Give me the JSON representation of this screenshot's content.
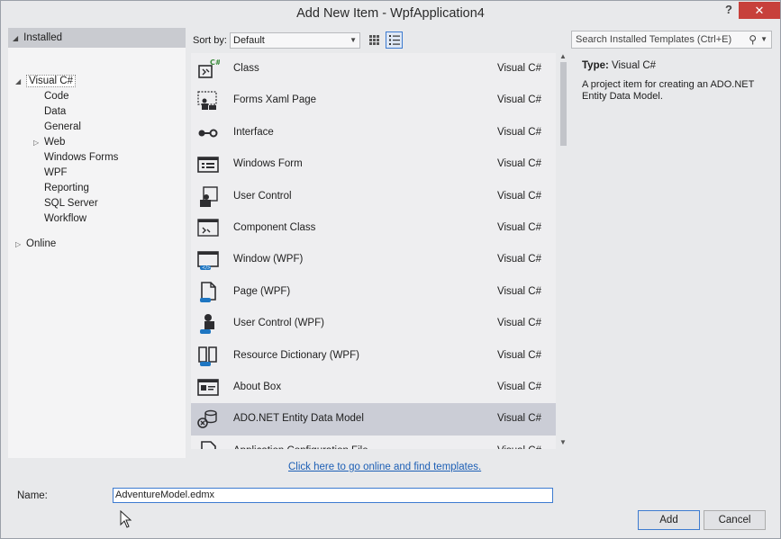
{
  "window": {
    "title": "Add New Item - WpfApplication4",
    "help_label": "?",
    "close_label": "✕"
  },
  "left_pane": {
    "installed_label": "Installed",
    "tree": [
      {
        "label": "Visual C#",
        "level": 0,
        "expanded": true,
        "selected": true
      },
      {
        "label": "Code",
        "level": 1
      },
      {
        "label": "Data",
        "level": 1
      },
      {
        "label": "General",
        "level": 1
      },
      {
        "label": "Web",
        "level": 1,
        "collapsible": true
      },
      {
        "label": "Windows Forms",
        "level": 1
      },
      {
        "label": "WPF",
        "level": 1
      },
      {
        "label": "Reporting",
        "level": 1
      },
      {
        "label": "SQL Server",
        "level": 1
      },
      {
        "label": "Workflow",
        "level": 1
      }
    ],
    "online_label": "Online"
  },
  "toolbar": {
    "sort_by_label": "Sort by:",
    "sort_by_value": "Default",
    "search_placeholder": "Search Installed Templates (Ctrl+E)"
  },
  "templates": [
    {
      "name": "Class",
      "lang": "Visual C#",
      "icon": "class-icon"
    },
    {
      "name": "Forms Xaml Page",
      "lang": "Visual C#",
      "icon": "forms-xaml-page-icon"
    },
    {
      "name": "Interface",
      "lang": "Visual C#",
      "icon": "interface-icon"
    },
    {
      "name": "Windows Form",
      "lang": "Visual C#",
      "icon": "windows-form-icon"
    },
    {
      "name": "User Control",
      "lang": "Visual C#",
      "icon": "user-control-icon"
    },
    {
      "name": "Component Class",
      "lang": "Visual C#",
      "icon": "component-class-icon"
    },
    {
      "name": "Window (WPF)",
      "lang": "Visual C#",
      "icon": "window-wpf-icon"
    },
    {
      "name": "Page (WPF)",
      "lang": "Visual C#",
      "icon": "page-wpf-icon"
    },
    {
      "name": "User Control (WPF)",
      "lang": "Visual C#",
      "icon": "user-control-wpf-icon"
    },
    {
      "name": "Resource Dictionary (WPF)",
      "lang": "Visual C#",
      "icon": "resource-dictionary-icon"
    },
    {
      "name": "About Box",
      "lang": "Visual C#",
      "icon": "about-box-icon"
    },
    {
      "name": "ADO.NET Entity Data Model",
      "lang": "Visual C#",
      "icon": "entity-data-model-icon",
      "selected": true
    },
    {
      "name": "Application Configuration File",
      "lang": "Visual C#",
      "icon": "config-file-icon"
    }
  ],
  "info": {
    "type_label": "Type:",
    "type_value": "Visual C#",
    "description": "A project item for creating an ADO.NET Entity Data Model."
  },
  "online_link": "Click here to go online and find templates.",
  "footer": {
    "name_label": "Name:",
    "name_value": "AdventureModel.edmx",
    "add_label": "Add",
    "cancel_label": "Cancel"
  },
  "colors": {
    "accent": "#3d7bd0",
    "selection": "#cbcdd6",
    "close": "#c7403b",
    "link": "#1d5fb5"
  }
}
